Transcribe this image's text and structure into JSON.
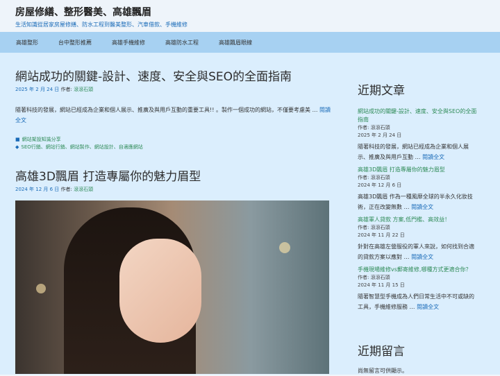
{
  "header": {
    "title": "房屋修繕、整形醫美、高雄飄眉",
    "description": "生活知識從居家房屋修繕、防水工程到醫美整形、汽車借款、手機維修"
  },
  "nav": [
    "高雄整形",
    "台中整形推薦",
    "高雄手機維修",
    "高雄防水工程",
    "高雄飄眉眼線"
  ],
  "posts": [
    {
      "title": "網站成功的關鍵-設計、速度、安全與SEO的全面指南",
      "date": "2025 年 2 月 24 日",
      "author_label": "作者:",
      "author": "滾滾石頭",
      "excerpt": "隨著科技的發展，網站已經成為企業和個人展示、推廣及與用戶互動的重要工具!! 。製作一個成功的網站，不僅要考慮美 …",
      "read_more": "閱讀全文",
      "category": "網站架設知識分享",
      "tags": "SEO行銷、網站行銷、網站製作、網站設計、自適應網站"
    },
    {
      "title": "高雄3D飄眉 打造專屬你的魅力眉型",
      "date": "2024 年 12 月 6 日",
      "author_label": "作者:",
      "author": "滾滾石頭"
    }
  ],
  "sidebar": {
    "recent_title": "近期文章",
    "recent": [
      {
        "title": "網站成功的關鍵-設計、速度、安全與SEO的全面指南",
        "author_line": "作者: 滾滾石頭",
        "date": "2025 年 2 月 24 日",
        "excerpt": "隨著科技的發展，網站已經成為企業和個人展示、推廣及與用戶互動 …",
        "read_more": "閱讀全文"
      },
      {
        "title": "高雄3D飄眉 打造專屬你的魅力眉型",
        "author_line": "作者: 滾滾石頭",
        "date": "2024 年 12 月 6 日",
        "excerpt": "高雄3D飄眉 作為一種風靡全球的半永久化妝技術，正在改變無數 …",
        "read_more": "閱讀全文"
      },
      {
        "title": "高雄軍人貸款 方案,低門檻、高效益！",
        "author_line": "作者: 滾滾石頭",
        "date": "2024 年 11 月 22 日",
        "excerpt": "針對在高雄左營服役的軍人來說，如何找到合適的貸款方案以應對 …",
        "read_more": "閱讀全文"
      },
      {
        "title": "手機現場維修vs郵寄維修,哪種方式更適合你？",
        "author_line": "作者: 滾滾石頭",
        "date": "2024 年 11 月 15 日",
        "excerpt": "隨著智慧型手機成為人們日常生活中不可或缺的工具，手機維修服務 …",
        "read_more": "閱讀全文"
      }
    ],
    "comments_title": "近期留言",
    "comments_empty": "尚無留言可供顯示。"
  }
}
